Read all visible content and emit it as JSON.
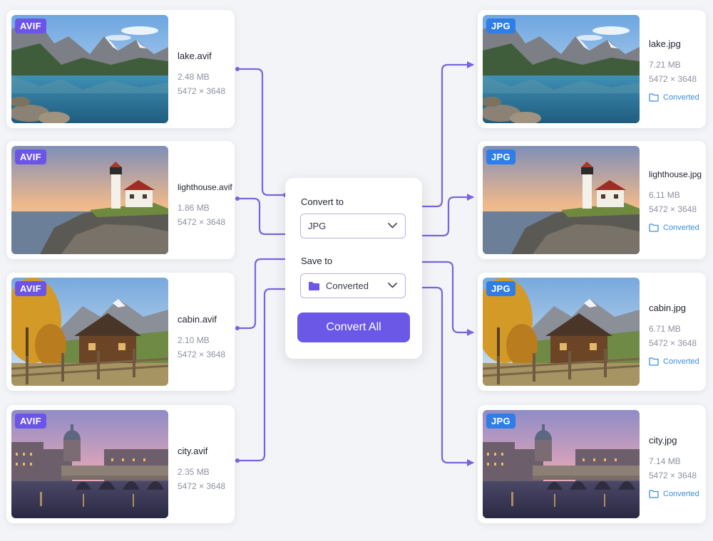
{
  "colors": {
    "accent": "#6c58e6",
    "avif_badge": "#6c55e6",
    "jpg_badge": "#2f7ee8",
    "connector": "#7a63e0",
    "converted_text": "#3b8ee0"
  },
  "sources": [
    {
      "badge": "AVIF",
      "name": "lake.avif",
      "size": "2.48 MB",
      "dims": "5472 × 3648",
      "scene": "lake"
    },
    {
      "badge": "AVIF",
      "name": "lighthouse.avif",
      "size": "1.86 MB",
      "dims": "5472 × 3648",
      "scene": "lighthouse"
    },
    {
      "badge": "AVIF",
      "name": "cabin.avif",
      "size": "2.10 MB",
      "dims": "5472 × 3648",
      "scene": "cabin"
    },
    {
      "badge": "AVIF",
      "name": "city.avif",
      "size": "2.35 MB",
      "dims": "5472 × 3648",
      "scene": "city"
    }
  ],
  "outputs": [
    {
      "badge": "JPG",
      "name": "lake.jpg",
      "size": "7.21 MB",
      "dims": "5472 × 3648",
      "folder": "Converted",
      "folder_icon": "folder-outline-icon"
    },
    {
      "badge": "JPG",
      "name": "lighthouse.jpg",
      "size": "6.11 MB",
      "dims": "5472 × 3648",
      "folder": "Converted",
      "folder_icon": "folder-outline-icon"
    },
    {
      "badge": "JPG",
      "name": "cabin.jpg",
      "size": "6.71 MB",
      "dims": "5472 × 3648",
      "folder": "Converted",
      "folder_icon": "folder-outline-icon"
    },
    {
      "badge": "JPG",
      "name": "city.jpg",
      "size": "7.14 MB",
      "dims": "5472 × 3648",
      "folder": "Converted",
      "folder_icon": "folder-outline-icon"
    }
  ],
  "panel": {
    "convert_to_label": "Convert to",
    "format_value": "JPG",
    "save_to_label": "Save to",
    "folder_value": "Converted",
    "folder_icon": "folder-filled-icon",
    "dropdown_icon": "chevron-down-icon",
    "convert_all_label": "Convert All"
  }
}
